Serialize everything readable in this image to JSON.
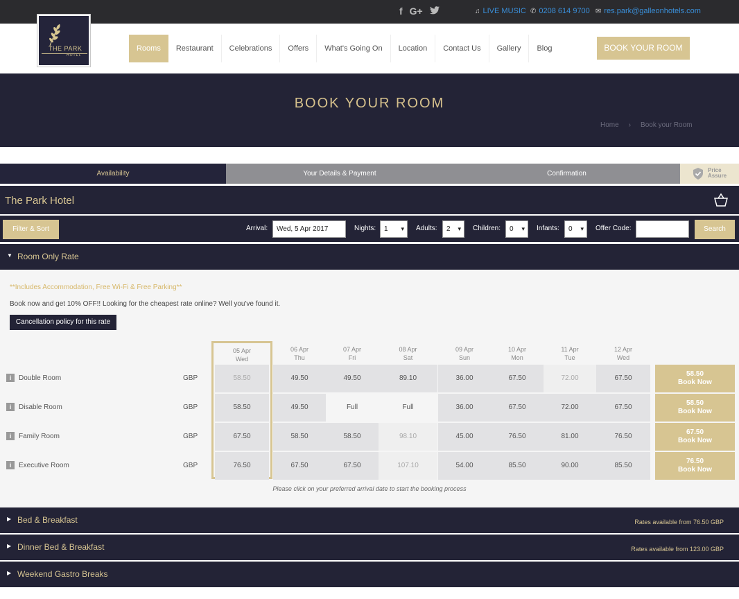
{
  "topbar": {
    "live_music": "LIVE MUSIC",
    "phone": "0208 614 9700",
    "email": "res.park@galleonhotels.com"
  },
  "logo": {
    "line1": "THE PARK",
    "line2": "HOTEL"
  },
  "nav": {
    "items": [
      "Rooms",
      "Restaurant",
      "Celebrations",
      "Offers",
      "What's Going On",
      "Location",
      "Contact Us",
      "Gallery",
      "Blog"
    ],
    "book_label": "BOOK YOUR ROOM"
  },
  "banner": {
    "title": "BOOK YOUR ROOM",
    "breadcrumb": [
      "Home",
      "›",
      "Book your Room"
    ]
  },
  "steps": [
    "Availability",
    "Your Details & Payment",
    "Confirmation"
  ],
  "price_assure": {
    "line1": "Price",
    "line2": "Assure"
  },
  "hotel": {
    "name": "The Park Hotel"
  },
  "filter": {
    "filter_sort": "Filter & Sort",
    "arrival_label": "Arrival:",
    "arrival_value": "Wed, 5 Apr 2017",
    "nights_label": "Nights:",
    "nights_value": "1",
    "adults_label": "Adults:",
    "adults_value": "2",
    "children_label": "Children:",
    "children_value": "0",
    "infants_label": "Infants:",
    "infants_value": "0",
    "offer_label": "Offer Code:",
    "offer_value": "",
    "search_label": "Search"
  },
  "sections": [
    {
      "title": "Room Only Rate",
      "rates_from": ""
    },
    {
      "title": "Bed & Breakfast",
      "rates_from": "Rates available from 76.50 GBP"
    },
    {
      "title": "Dinner Bed & Breakfast",
      "rates_from": "Rates available from 123.00 GBP"
    },
    {
      "title": "Weekend Gastro Breaks",
      "rates_from": ""
    }
  ],
  "rate": {
    "includes": "**Includes Accommodation, Free Wi-Fi & Free Parking**",
    "promo": "Book now and get 10% OFF!! Looking for the cheapest rate online? Well you've found it.",
    "cancel_label": "Cancellation policy for this rate",
    "hint": "Please click on your preferred arrival date to start the booking process"
  },
  "dates": [
    {
      "date": "05 Apr",
      "day": "Wed"
    },
    {
      "date": "06 Apr",
      "day": "Thu"
    },
    {
      "date": "07 Apr",
      "day": "Fri"
    },
    {
      "date": "08 Apr",
      "day": "Sat"
    },
    {
      "date": "09 Apr",
      "day": "Sun"
    },
    {
      "date": "10 Apr",
      "day": "Mon"
    },
    {
      "date": "11 Apr",
      "day": "Tue"
    },
    {
      "date": "12 Apr",
      "day": "Wed"
    }
  ],
  "rooms": [
    {
      "name": "Double Room",
      "currency": "GBP",
      "prices": [
        "58.50",
        "49.50",
        "49.50",
        "89.10",
        "36.00",
        "67.50",
        "72.00",
        "67.50"
      ],
      "book_price": "58.50",
      "book_label": "Book Now"
    },
    {
      "name": "Disable Room",
      "currency": "GBP",
      "prices": [
        "58.50",
        "49.50",
        "Full",
        "Full",
        "36.00",
        "67.50",
        "72.00",
        "67.50"
      ],
      "book_price": "58.50",
      "book_label": "Book Now"
    },
    {
      "name": "Family Room",
      "currency": "GBP",
      "prices": [
        "67.50",
        "58.50",
        "58.50",
        "98.10",
        "45.00",
        "76.50",
        "81.00",
        "76.50"
      ],
      "book_price": "67.50",
      "book_label": "Book Now"
    },
    {
      "name": "Executive Room",
      "currency": "GBP",
      "prices": [
        "76.50",
        "67.50",
        "67.50",
        "107.10",
        "54.00",
        "85.50",
        "90.00",
        "85.50"
      ],
      "book_price": "76.50",
      "book_label": "Book Now"
    }
  ]
}
